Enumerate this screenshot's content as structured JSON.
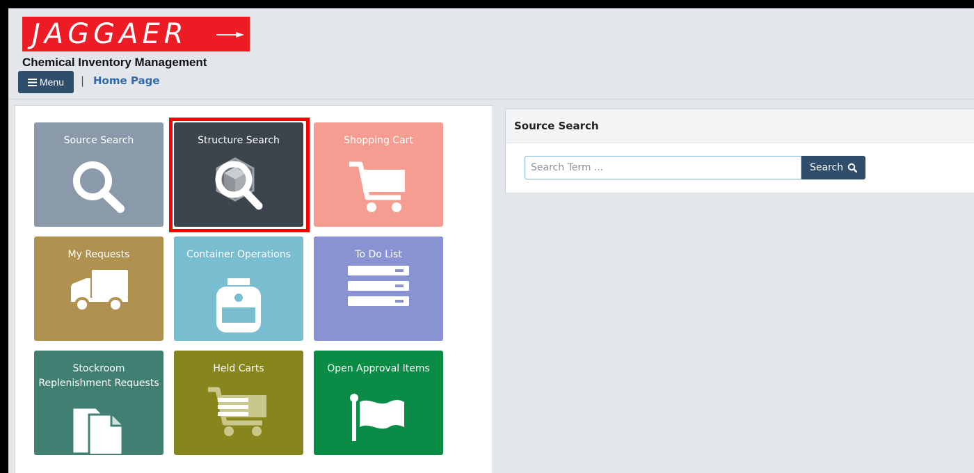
{
  "header": {
    "logo_text": "JAGGAER",
    "app_title": "Chemical Inventory Management",
    "menu_label": "Menu",
    "separator": "|",
    "home_link": "Home Page"
  },
  "tiles": [
    {
      "label": "Source Search",
      "icon": "magnifier-icon",
      "color": "#8a9aab"
    },
    {
      "label": "Structure Search",
      "icon": "structure-search-icon",
      "color": "#3c444d"
    },
    {
      "label": "Shopping Cart",
      "icon": "shopping-cart-icon",
      "color": "#f59d90"
    },
    {
      "label": "My Requests",
      "icon": "truck-icon",
      "color": "#b1914f"
    },
    {
      "label": "Container Operations",
      "icon": "container-jar-icon",
      "color": "#79bdd1"
    },
    {
      "label": "To Do List",
      "icon": "list-icon",
      "color": "#8a93d2"
    },
    {
      "label": "Stockroom Replenishment Requests",
      "icon": "documents-icon",
      "color": "#417f72"
    },
    {
      "label": "Held Carts",
      "icon": "held-cart-icon",
      "color": "#87861c"
    },
    {
      "label": "Open Approval Items",
      "icon": "flag-icon",
      "color": "#0a8b46"
    }
  ],
  "search": {
    "panel_title": "Source Search",
    "placeholder": "Search Term ...",
    "button_label": "Search"
  },
  "colors": {
    "logo_red": "#ed1c24",
    "nav_blue": "#2e4e6b",
    "link_blue": "#2f6aa8",
    "highlight": "#ff0000"
  }
}
